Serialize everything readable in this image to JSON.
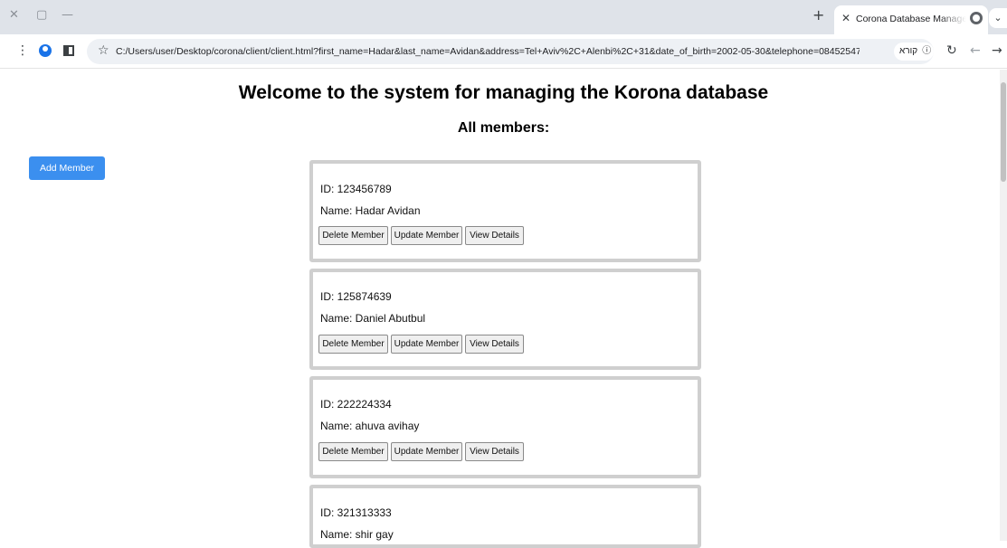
{
  "browser": {
    "tab_title": "Corona Database Managemen",
    "url": "C:/Users/user/Desktop/corona/client/client.html?first_name=Hadar&last_name=Avidan&address=Tel+Aviv%2C+Alenbi%2C+31&date_of_birth=2002-05-30&telephone=084525476&mobile_...",
    "reader_chip_label": "קורא",
    "icons": [
      "close-icon",
      "restore-icon",
      "minimize-icon",
      "new-tab-icon",
      "globe-icon",
      "tab-search-icon",
      "menu-icon",
      "profile-icon",
      "side-panel-icon",
      "star-icon",
      "info-icon",
      "reload-icon",
      "back-icon",
      "forward-icon"
    ]
  },
  "page": {
    "title": "Welcome to the system for managing the Korona database",
    "subtitle": "All members:",
    "add_button_label": "Add Member"
  },
  "members": [
    {
      "id_line": "ID: 123456789",
      "name_line": "Name: Hadar Avidan"
    },
    {
      "id_line": "ID: 125874639",
      "name_line": "Name: Daniel Abutbul"
    },
    {
      "id_line": "ID: 222224334",
      "name_line": "Name: ahuva avihay"
    },
    {
      "id_line": "ID: 321313333",
      "name_line": "Name: shir gay"
    }
  ],
  "card_actions": {
    "delete_label": "Delete Member",
    "update_label": "Update Member",
    "view_label": "View Details"
  },
  "colors": {
    "accent": "#3b8fef",
    "card_border": "#cfcfcf",
    "tabstrip": "#dfe3e9"
  }
}
